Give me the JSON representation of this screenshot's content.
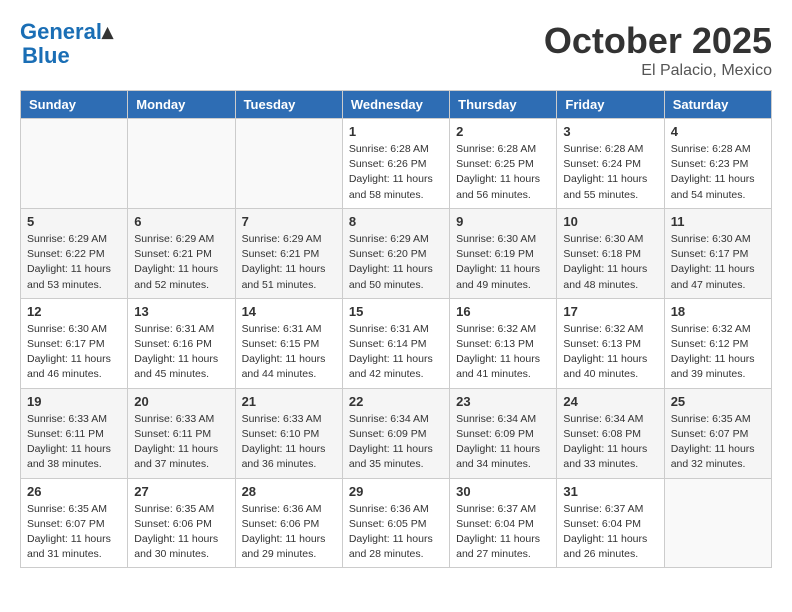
{
  "header": {
    "logo_line1": "General",
    "logo_line2": "Blue",
    "month": "October 2025",
    "location": "El Palacio, Mexico"
  },
  "weekdays": [
    "Sunday",
    "Monday",
    "Tuesday",
    "Wednesday",
    "Thursday",
    "Friday",
    "Saturday"
  ],
  "weeks": [
    [
      {
        "day": "",
        "info": ""
      },
      {
        "day": "",
        "info": ""
      },
      {
        "day": "",
        "info": ""
      },
      {
        "day": "1",
        "info": "Sunrise: 6:28 AM\nSunset: 6:26 PM\nDaylight: 11 hours\nand 58 minutes."
      },
      {
        "day": "2",
        "info": "Sunrise: 6:28 AM\nSunset: 6:25 PM\nDaylight: 11 hours\nand 56 minutes."
      },
      {
        "day": "3",
        "info": "Sunrise: 6:28 AM\nSunset: 6:24 PM\nDaylight: 11 hours\nand 55 minutes."
      },
      {
        "day": "4",
        "info": "Sunrise: 6:28 AM\nSunset: 6:23 PM\nDaylight: 11 hours\nand 54 minutes."
      }
    ],
    [
      {
        "day": "5",
        "info": "Sunrise: 6:29 AM\nSunset: 6:22 PM\nDaylight: 11 hours\nand 53 minutes."
      },
      {
        "day": "6",
        "info": "Sunrise: 6:29 AM\nSunset: 6:21 PM\nDaylight: 11 hours\nand 52 minutes."
      },
      {
        "day": "7",
        "info": "Sunrise: 6:29 AM\nSunset: 6:21 PM\nDaylight: 11 hours\nand 51 minutes."
      },
      {
        "day": "8",
        "info": "Sunrise: 6:29 AM\nSunset: 6:20 PM\nDaylight: 11 hours\nand 50 minutes."
      },
      {
        "day": "9",
        "info": "Sunrise: 6:30 AM\nSunset: 6:19 PM\nDaylight: 11 hours\nand 49 minutes."
      },
      {
        "day": "10",
        "info": "Sunrise: 6:30 AM\nSunset: 6:18 PM\nDaylight: 11 hours\nand 48 minutes."
      },
      {
        "day": "11",
        "info": "Sunrise: 6:30 AM\nSunset: 6:17 PM\nDaylight: 11 hours\nand 47 minutes."
      }
    ],
    [
      {
        "day": "12",
        "info": "Sunrise: 6:30 AM\nSunset: 6:17 PM\nDaylight: 11 hours\nand 46 minutes."
      },
      {
        "day": "13",
        "info": "Sunrise: 6:31 AM\nSunset: 6:16 PM\nDaylight: 11 hours\nand 45 minutes."
      },
      {
        "day": "14",
        "info": "Sunrise: 6:31 AM\nSunset: 6:15 PM\nDaylight: 11 hours\nand 44 minutes."
      },
      {
        "day": "15",
        "info": "Sunrise: 6:31 AM\nSunset: 6:14 PM\nDaylight: 11 hours\nand 42 minutes."
      },
      {
        "day": "16",
        "info": "Sunrise: 6:32 AM\nSunset: 6:13 PM\nDaylight: 11 hours\nand 41 minutes."
      },
      {
        "day": "17",
        "info": "Sunrise: 6:32 AM\nSunset: 6:13 PM\nDaylight: 11 hours\nand 40 minutes."
      },
      {
        "day": "18",
        "info": "Sunrise: 6:32 AM\nSunset: 6:12 PM\nDaylight: 11 hours\nand 39 minutes."
      }
    ],
    [
      {
        "day": "19",
        "info": "Sunrise: 6:33 AM\nSunset: 6:11 PM\nDaylight: 11 hours\nand 38 minutes."
      },
      {
        "day": "20",
        "info": "Sunrise: 6:33 AM\nSunset: 6:11 PM\nDaylight: 11 hours\nand 37 minutes."
      },
      {
        "day": "21",
        "info": "Sunrise: 6:33 AM\nSunset: 6:10 PM\nDaylight: 11 hours\nand 36 minutes."
      },
      {
        "day": "22",
        "info": "Sunrise: 6:34 AM\nSunset: 6:09 PM\nDaylight: 11 hours\nand 35 minutes."
      },
      {
        "day": "23",
        "info": "Sunrise: 6:34 AM\nSunset: 6:09 PM\nDaylight: 11 hours\nand 34 minutes."
      },
      {
        "day": "24",
        "info": "Sunrise: 6:34 AM\nSunset: 6:08 PM\nDaylight: 11 hours\nand 33 minutes."
      },
      {
        "day": "25",
        "info": "Sunrise: 6:35 AM\nSunset: 6:07 PM\nDaylight: 11 hours\nand 32 minutes."
      }
    ],
    [
      {
        "day": "26",
        "info": "Sunrise: 6:35 AM\nSunset: 6:07 PM\nDaylight: 11 hours\nand 31 minutes."
      },
      {
        "day": "27",
        "info": "Sunrise: 6:35 AM\nSunset: 6:06 PM\nDaylight: 11 hours\nand 30 minutes."
      },
      {
        "day": "28",
        "info": "Sunrise: 6:36 AM\nSunset: 6:06 PM\nDaylight: 11 hours\nand 29 minutes."
      },
      {
        "day": "29",
        "info": "Sunrise: 6:36 AM\nSunset: 6:05 PM\nDaylight: 11 hours\nand 28 minutes."
      },
      {
        "day": "30",
        "info": "Sunrise: 6:37 AM\nSunset: 6:04 PM\nDaylight: 11 hours\nand 27 minutes."
      },
      {
        "day": "31",
        "info": "Sunrise: 6:37 AM\nSunset: 6:04 PM\nDaylight: 11 hours\nand 26 minutes."
      },
      {
        "day": "",
        "info": ""
      }
    ]
  ]
}
